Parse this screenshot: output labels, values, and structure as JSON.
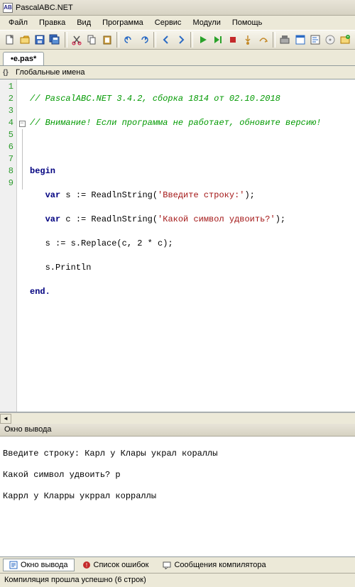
{
  "window": {
    "title": "PascalABC.NET"
  },
  "menu": [
    "Файл",
    "Правка",
    "Вид",
    "Программа",
    "Сервис",
    "Модули",
    "Помощь"
  ],
  "tab": {
    "label": "•e.pas*"
  },
  "names_panel": {
    "label": "Глобальные имена"
  },
  "code": {
    "line_numbers": [
      "1",
      "2",
      "3",
      "4",
      "5",
      "6",
      "7",
      "8",
      "9"
    ],
    "lines": [
      {
        "t": "comment",
        "text": "// PascalABC.NET 3.4.2, сборка 1814 от 02.10.2018"
      },
      {
        "t": "comment",
        "text": "// Внимание! Если программа не работает, обновите версию!"
      },
      {
        "t": "blank",
        "text": ""
      },
      {
        "t": "begin",
        "kw": "begin"
      },
      {
        "t": "var1",
        "kw": "var",
        "mid": " s := ReadlnString(",
        "str": "'Введите строку:'",
        "end": ");"
      },
      {
        "t": "var2",
        "kw": "var",
        "mid": " c := ReadlnString(",
        "str": "'Какой символ удвоить?'",
        "end": ");"
      },
      {
        "t": "stmt",
        "text": "s := s.Replace(c, 2 * c);"
      },
      {
        "t": "stmt",
        "text": "s.Println"
      },
      {
        "t": "end",
        "kw": "end."
      }
    ]
  },
  "output_panel": {
    "title": "Окно вывода",
    "lines": [
      "Введите строку: Карл у Клары украл кораллы",
      "Какой символ удвоить? р",
      "Каррл у Кларры укррал корраллы"
    ]
  },
  "bottom_tabs": [
    {
      "label": "Окно вывода",
      "active": true
    },
    {
      "label": "Список ошибок",
      "active": false
    },
    {
      "label": "Сообщения компилятора",
      "active": false
    }
  ],
  "status": {
    "text": "Компиляция прошла успешно (6 строк)"
  }
}
